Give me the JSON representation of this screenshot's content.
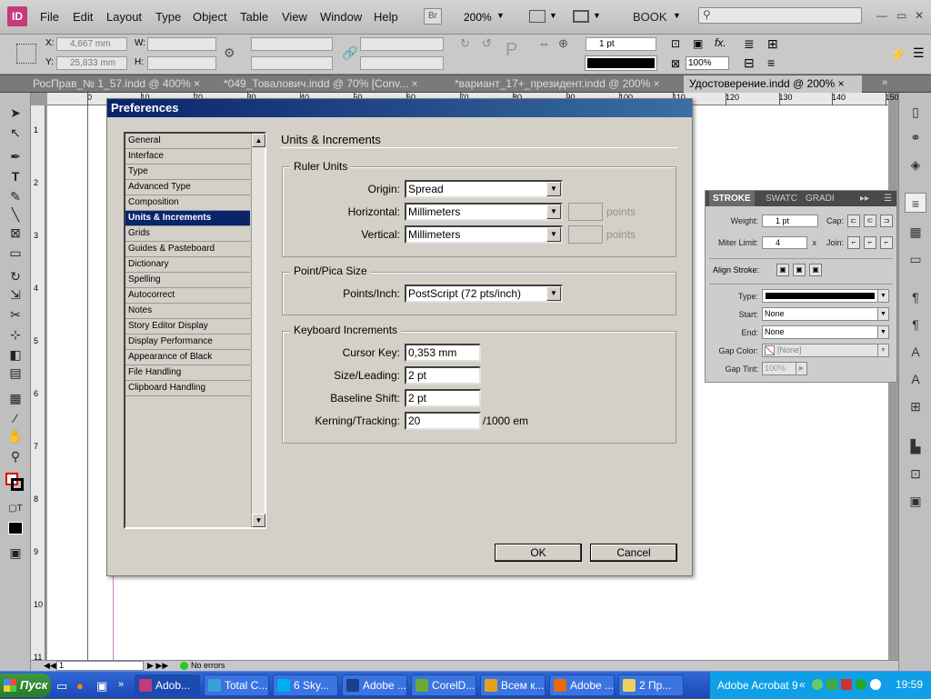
{
  "app": {
    "logo": "ID",
    "menu": [
      "File",
      "Edit",
      "Layout",
      "Type",
      "Object",
      "Table",
      "View",
      "Window",
      "Help"
    ],
    "bridge_label": "Br",
    "zoom": "200%",
    "workspace": "BOOK",
    "search_placeholder": ""
  },
  "control_bar": {
    "x_label": "X:",
    "x_value": "4,667 mm",
    "y_label": "Y:",
    "y_value": "25,833 mm",
    "w_label": "W:",
    "h_label": "H:",
    "stroke_weight": "1 pt",
    "scale": "100%"
  },
  "tabs": [
    {
      "label": "РосПрав_№ 1_57.indd @ 400%"
    },
    {
      "label": "*049_Товалович.indd @ 70% [Conv..."
    },
    {
      "label": "*вариант_17+_президент.indd @ 200%"
    },
    {
      "label": "Удостоверение.indd @ 200%"
    }
  ],
  "ruler": {
    "h_ticks": [
      "0",
      "10",
      "20",
      "30",
      "40",
      "50",
      "60",
      "70",
      "80",
      "90",
      "100",
      "110",
      "120",
      "130",
      "140",
      "150"
    ],
    "v_ticks": [
      "1",
      "2",
      "3",
      "4",
      "5",
      "6",
      "7",
      "8",
      "9",
      "10",
      "11"
    ]
  },
  "statusbar": {
    "page": "1",
    "errors": "No errors"
  },
  "dialog": {
    "title": "Preferences",
    "categories": [
      {
        "label": "General"
      },
      {
        "label": "Interface"
      },
      {
        "label": "Type"
      },
      {
        "label": "Advanced Type"
      },
      {
        "label": "Composition"
      },
      {
        "label": "Units & Increments",
        "selected": true
      },
      {
        "label": "Grids"
      },
      {
        "label": "Guides & Pasteboard"
      },
      {
        "label": "Dictionary"
      },
      {
        "label": "Spelling"
      },
      {
        "label": "Autocorrect"
      },
      {
        "label": "Notes"
      },
      {
        "label": "Story Editor Display"
      },
      {
        "label": "Display Performance"
      },
      {
        "label": "Appearance of Black"
      },
      {
        "label": "File Handling"
      },
      {
        "label": "Clipboard Handling"
      }
    ],
    "section_title": "Units & Increments",
    "ruler_units": {
      "group": "Ruler Units",
      "origin_label": "Origin:",
      "origin_value": "Spread",
      "horizontal_label": "Horizontal:",
      "horizontal_value": "Millimeters",
      "vertical_label": "Vertical:",
      "vertical_value": "Millimeters",
      "points_suffix": "points"
    },
    "point_pica": {
      "group": "Point/Pica Size",
      "label": "Points/Inch:",
      "value": "PostScript (72 pts/inch)"
    },
    "keyboard": {
      "group": "Keyboard Increments",
      "cursor_label": "Cursor Key:",
      "cursor_value": "0,353 mm",
      "size_label": "Size/Leading:",
      "size_value": "2 pt",
      "baseline_label": "Baseline Shift:",
      "baseline_value": "2 pt",
      "kerning_label": "Kerning/Tracking:",
      "kerning_value": "20",
      "kerning_suffix": "/1000 em"
    },
    "ok": "OK",
    "cancel": "Cancel"
  },
  "stroke_panel": {
    "tabs": [
      "STROKE",
      "SWATC",
      "GRADI"
    ],
    "weight_label": "Weight:",
    "weight_value": "1 pt",
    "cap_label": "Cap:",
    "miter_label": "Miter Limit:",
    "miter_value": "4",
    "miter_x": "x",
    "join_label": "Join:",
    "align_label": "Align Stroke:",
    "type_label": "Type:",
    "start_label": "Start:",
    "start_value": "None",
    "end_label": "End:",
    "end_value": "None",
    "gap_color_label": "Gap Color:",
    "gap_color_value": "[None]",
    "gap_tint_label": "Gap Tint:",
    "gap_tint_value": "100%"
  },
  "taskbar": {
    "start": "Пуск",
    "tasks": [
      {
        "label": "Adob...",
        "color": "#c43a7a"
      },
      {
        "label": "Total C...",
        "color": "#3aa0d8"
      },
      {
        "label": "6 Sky...",
        "color": "#00aff0"
      },
      {
        "label": "Adobe ...",
        "color": "#1c3f8c"
      },
      {
        "label": "CorelD...",
        "color": "#6aa83a"
      },
      {
        "label": "Всем к...",
        "color": "#e0a020"
      },
      {
        "label": "Adobe ...",
        "color": "#e86a10"
      },
      {
        "label": "2 Пр...",
        "color": "#f0d060"
      }
    ],
    "tray_app": "Adobe Acrobat 9",
    "clock": "19:59"
  }
}
